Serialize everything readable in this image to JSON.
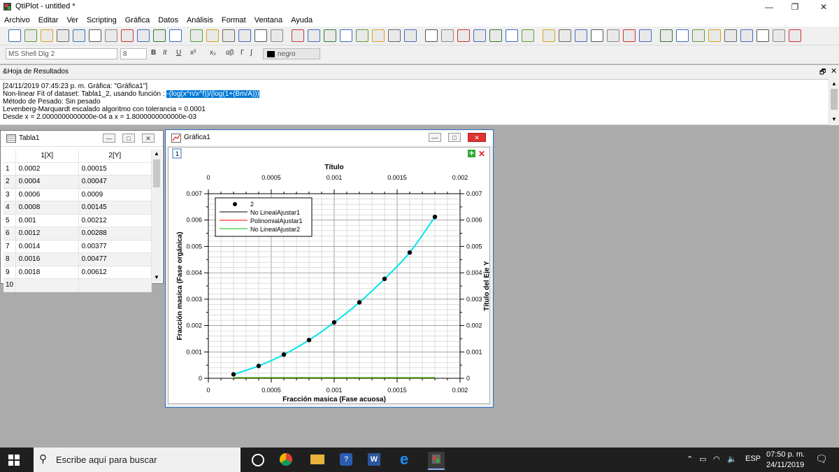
{
  "app": {
    "title": "QtiPlot - untitled *"
  },
  "menu": [
    "Archivo",
    "Editar",
    "Ver",
    "Scripting",
    "Gráfica",
    "Datos",
    "Análisis",
    "Format",
    "Ventana",
    "Ayuda"
  ],
  "toolbar2": {
    "font": "MS Shell Dlg 2",
    "size": "8",
    "bold": "B",
    "italic": "It",
    "underline": "U",
    "sup": "x²",
    "sub": "x₂",
    "greek": "αβ",
    "gamma": "Γ",
    "integral": "∫",
    "color": "negro"
  },
  "results": {
    "header": "&Hoja de Resultados",
    "lines": [
      "[24/11/2019 07:45:23 p. m.        Gráfica: \"Gráfica1\"]",
      "Non-linear Fit of dataset: Tabla1_2, usando función : ",
      "Método de Pesado: Sin pesado",
      "Levenberg-Marquardt escalado algoritmo con tolerancia = 0.0001",
      "Desde x = 2.0000000000000e-04 a x = 1.8000000000000e-03"
    ],
    "highlight": "-(log(x^n/x^f))/(log(1+(Bm/A)))"
  },
  "table": {
    "title": "Tabla1",
    "columns": [
      "1[X]",
      "2[Y]"
    ],
    "rows": [
      [
        "1",
        "0.0002",
        "0.00015"
      ],
      [
        "2",
        "0.0004",
        "0.00047"
      ],
      [
        "3",
        "0.0006",
        "0.0009"
      ],
      [
        "4",
        "0.0008",
        "0.00145"
      ],
      [
        "5",
        "0.001",
        "0.00212"
      ],
      [
        "6",
        "0.0012",
        "0.00288"
      ],
      [
        "7",
        "0.0014",
        "0.00377"
      ],
      [
        "8",
        "0.0016",
        "0.00477"
      ],
      [
        "9",
        "0.0018",
        "0.00612"
      ],
      [
        "10",
        "",
        ""
      ]
    ]
  },
  "graph": {
    "title": "Gráfica1",
    "layer": "1",
    "colors": {
      "points": "#000000",
      "fit1": "#000000",
      "poly": "#ff0000",
      "fit2": "#00c000",
      "fitcurve": "#00e5ee"
    }
  },
  "chart_data": {
    "type": "scatter",
    "title": "Título",
    "xlabel": "Fracción masica (Fase acuosa)",
    "ylabel": "Fracción masica (Fase orgánica)",
    "ylabel_right": "Título del Eje Y",
    "xlim": [
      0,
      0.002
    ],
    "ylim": [
      0,
      0.007
    ],
    "x_ticks": [
      "0",
      "0.0005",
      "0.001",
      "0.0015",
      "0.002"
    ],
    "y_ticks": [
      "0",
      "0.001",
      "0.002",
      "0.003",
      "0.004",
      "0.005",
      "0.006",
      "0.007"
    ],
    "grid": true,
    "legend_position": "top-left",
    "legend": [
      "2",
      "No LinealAjustar1",
      "PolinomialAjustar1",
      "No LinealAjustar2"
    ],
    "x": [
      0.0002,
      0.0004,
      0.0006,
      0.0008,
      0.001,
      0.0012,
      0.0014,
      0.0016,
      0.0018
    ],
    "y": [
      0.00015,
      0.00047,
      0.0009,
      0.00145,
      0.00212,
      0.00288,
      0.00377,
      0.00477,
      0.00612
    ]
  },
  "taskbar": {
    "search_placeholder": "Escribe aquí para buscar",
    "lang": "ESP",
    "time": "07:50 p. m.",
    "date": "24/11/2019"
  }
}
